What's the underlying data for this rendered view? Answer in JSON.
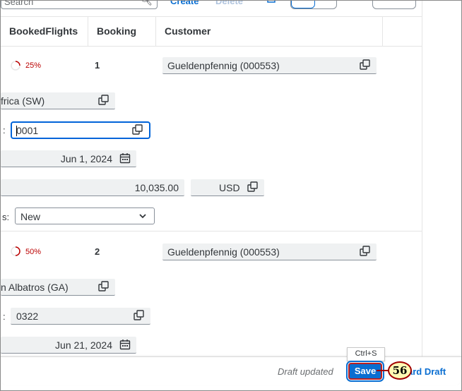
{
  "toolbar": {
    "search_placeholder": "Search",
    "create_label": "Create",
    "delete_label": "Delete"
  },
  "table": {
    "columns": [
      "BookedFlights",
      "Booking",
      "Customer"
    ],
    "rows": [
      {
        "progress": "25%",
        "booking": "1",
        "customer": "Gueldenpfennig (000553)",
        "airline": "frica (SW)",
        "conn_label": ":",
        "connection": "0001",
        "date": "Jun 1, 2024",
        "price": "10,035.00",
        "currency": "USD",
        "status_label": "s:",
        "status": "New"
      },
      {
        "progress": "50%",
        "booking": "2",
        "customer": "Gueldenpfennig (000553)",
        "airline": "n Albatros (GA)",
        "conn_label": ":",
        "connection": "0322",
        "date": "Jun 21, 2024"
      }
    ]
  },
  "footer": {
    "draft_status": "Draft updated",
    "save_label": "Save",
    "save_tooltip": "Ctrl+S",
    "discard_label": "ard Draft",
    "step_number": "56"
  },
  "colors": {
    "accent": "#0a6ed1",
    "progress_red": "#bb0000",
    "callout_fill": "#fff9b3",
    "callout_border": "#a00000"
  }
}
